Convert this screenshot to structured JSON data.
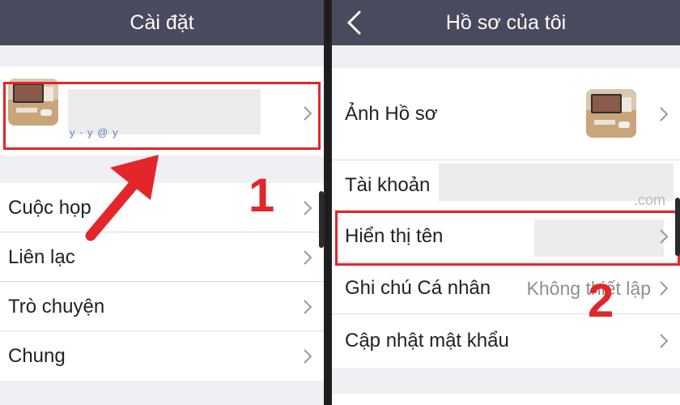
{
  "left": {
    "title": "Cài đặt",
    "profile_partial": "y  ·  y  @  y",
    "menu": [
      "Cuộc họp",
      "Liên lạc",
      "Trò chuyện",
      "Chung"
    ]
  },
  "right": {
    "title": "Hồ sơ của tôi",
    "rows": {
      "avatar": "Ảnh Hồ sơ",
      "account": "Tài khoản",
      "account_suffix": ".com",
      "display_name": "Hiển thị tên",
      "note": "Ghi chú Cá nhân",
      "note_value": "Không thiết lập",
      "password": "Cập nhật mật khẩu"
    }
  },
  "markers": {
    "step1": "1",
    "step2": "2"
  },
  "colors": {
    "accent": "#e3262a",
    "topbar": "#4a4a5e",
    "background": "#efeff4"
  },
  "icons": [
    "chevron-right-icon",
    "back-arrow-icon",
    "red-arrow-icon"
  ]
}
